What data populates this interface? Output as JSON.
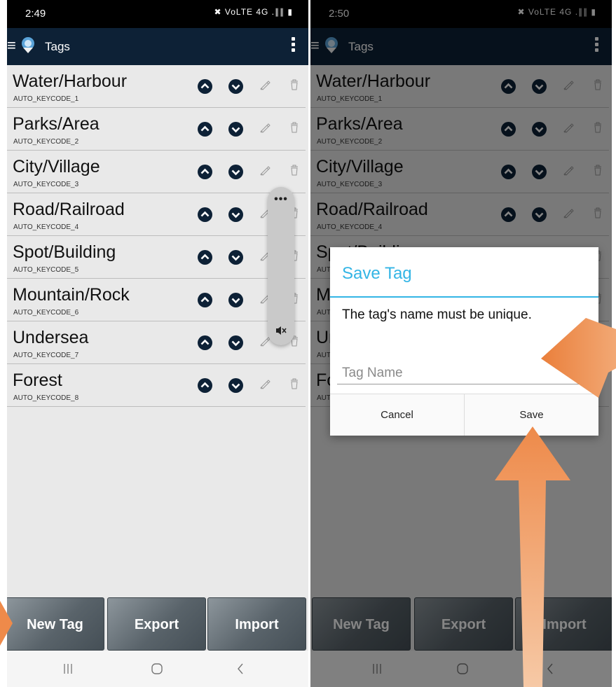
{
  "screens": {
    "left": {
      "status_time": "2:49",
      "app_title": "Tags",
      "tags": [
        {
          "name": "Water/Harbour",
          "code": "AUTO_KEYCODE_1"
        },
        {
          "name": "Parks/Area",
          "code": "AUTO_KEYCODE_2"
        },
        {
          "name": "City/Village",
          "code": "AUTO_KEYCODE_3"
        },
        {
          "name": "Road/Railroad",
          "code": "AUTO_KEYCODE_4"
        },
        {
          "name": "Spot/Building",
          "code": "AUTO_KEYCODE_5"
        },
        {
          "name": "Mountain/Rock",
          "code": "AUTO_KEYCODE_6"
        },
        {
          "name": "Undersea",
          "code": "AUTO_KEYCODE_7"
        },
        {
          "name": "Forest",
          "code": "AUTO_KEYCODE_8"
        }
      ],
      "volume_more": "•••",
      "buttons": {
        "new_tag": "New Tag",
        "export": "Export",
        "import": "Import"
      }
    },
    "right": {
      "status_time": "2:50",
      "app_title": "Tags",
      "tags": [
        {
          "name": "Water/Harbour",
          "code": "AUTO_KEYCODE_1"
        },
        {
          "name": "Parks/Area",
          "code": "AUTO_KEYCODE_2"
        },
        {
          "name": "City/Village",
          "code": "AUTO_KEYCODE_3"
        },
        {
          "name": "Road/Railroad",
          "code": "AUTO_KEYCODE_4"
        },
        {
          "name": "Spot/Building",
          "code": "AUTO_KEYCODE_5"
        },
        {
          "name": "Mountain/Rock",
          "code": "AUTO_KEYCODE_6"
        },
        {
          "name": "Undersea",
          "code": "AUTO_KEYCODE_7"
        },
        {
          "name": "Forest",
          "code": "AUTO_KEYCODE_8"
        }
      ],
      "buttons": {
        "new_tag": "New Tag",
        "export": "Export",
        "import": "Import"
      },
      "dialog": {
        "title": "Save Tag",
        "message": "The tag's name must be unique.",
        "input_placeholder": "Tag Name",
        "cancel": "Cancel",
        "save": "Save"
      }
    }
  },
  "status_icons": "✖ VoLTE 4G .∥∥ ▮",
  "colors": {
    "app_bar": "#0d2136",
    "dialog_accent": "#33b5e5",
    "annotation_arrow": "#ee8a4a",
    "list_background": "#e9e9e9"
  },
  "icons": {
    "move_up": "chevron-up-circle-icon",
    "move_down": "chevron-down-circle-icon",
    "edit": "pencil-icon",
    "delete": "trash-icon",
    "menu": "hamburger-icon",
    "overflow": "more-vertical-icon",
    "mute": "mute-icon"
  }
}
